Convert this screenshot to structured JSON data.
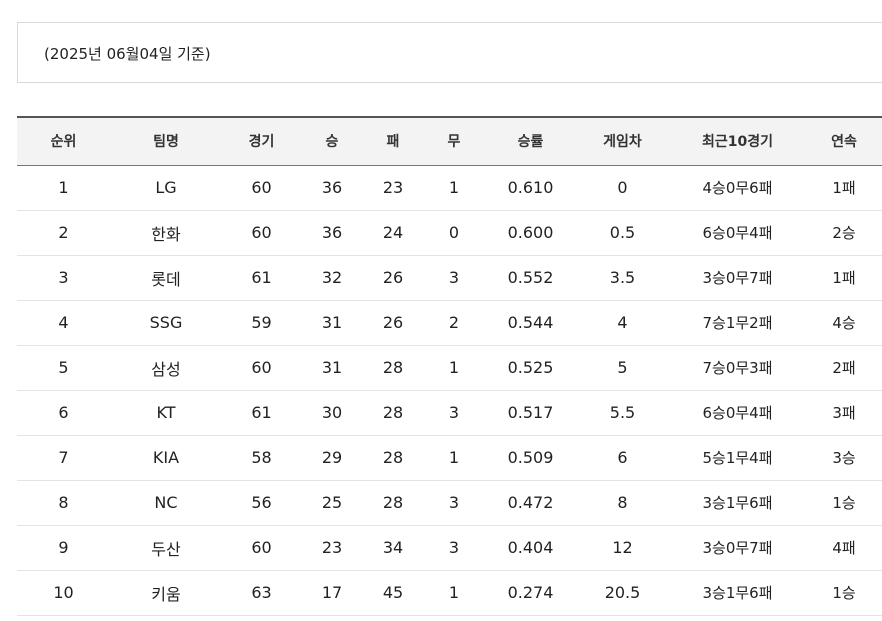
{
  "date_label": "(2025년 06월04일 기준)",
  "columns": [
    "순위",
    "팀명",
    "경기",
    "승",
    "패",
    "무",
    "승률",
    "게임차",
    "최근10경기",
    "연속"
  ],
  "rows": [
    [
      "1",
      "LG",
      "60",
      "36",
      "23",
      "1",
      "0.610",
      "0",
      "4승0무6패",
      "1패"
    ],
    [
      "2",
      "한화",
      "60",
      "36",
      "24",
      "0",
      "0.600",
      "0.5",
      "6승0무4패",
      "2승"
    ],
    [
      "3",
      "롯데",
      "61",
      "32",
      "26",
      "3",
      "0.552",
      "3.5",
      "3승0무7패",
      "1패"
    ],
    [
      "4",
      "SSG",
      "59",
      "31",
      "26",
      "2",
      "0.544",
      "4",
      "7승1무2패",
      "4승"
    ],
    [
      "5",
      "삼성",
      "60",
      "31",
      "28",
      "1",
      "0.525",
      "5",
      "7승0무3패",
      "2패"
    ],
    [
      "6",
      "KT",
      "61",
      "30",
      "28",
      "3",
      "0.517",
      "5.5",
      "6승0무4패",
      "3패"
    ],
    [
      "7",
      "KIA",
      "58",
      "29",
      "28",
      "1",
      "0.509",
      "6",
      "5승1무4패",
      "3승"
    ],
    [
      "8",
      "NC",
      "56",
      "25",
      "28",
      "3",
      "0.472",
      "8",
      "3승1무6패",
      "1승"
    ],
    [
      "9",
      "두산",
      "60",
      "23",
      "34",
      "3",
      "0.404",
      "12",
      "3승0무7패",
      "4패"
    ],
    [
      "10",
      "키움",
      "63",
      "17",
      "45",
      "1",
      "0.274",
      "20.5",
      "3승1무6패",
      "1승"
    ]
  ]
}
